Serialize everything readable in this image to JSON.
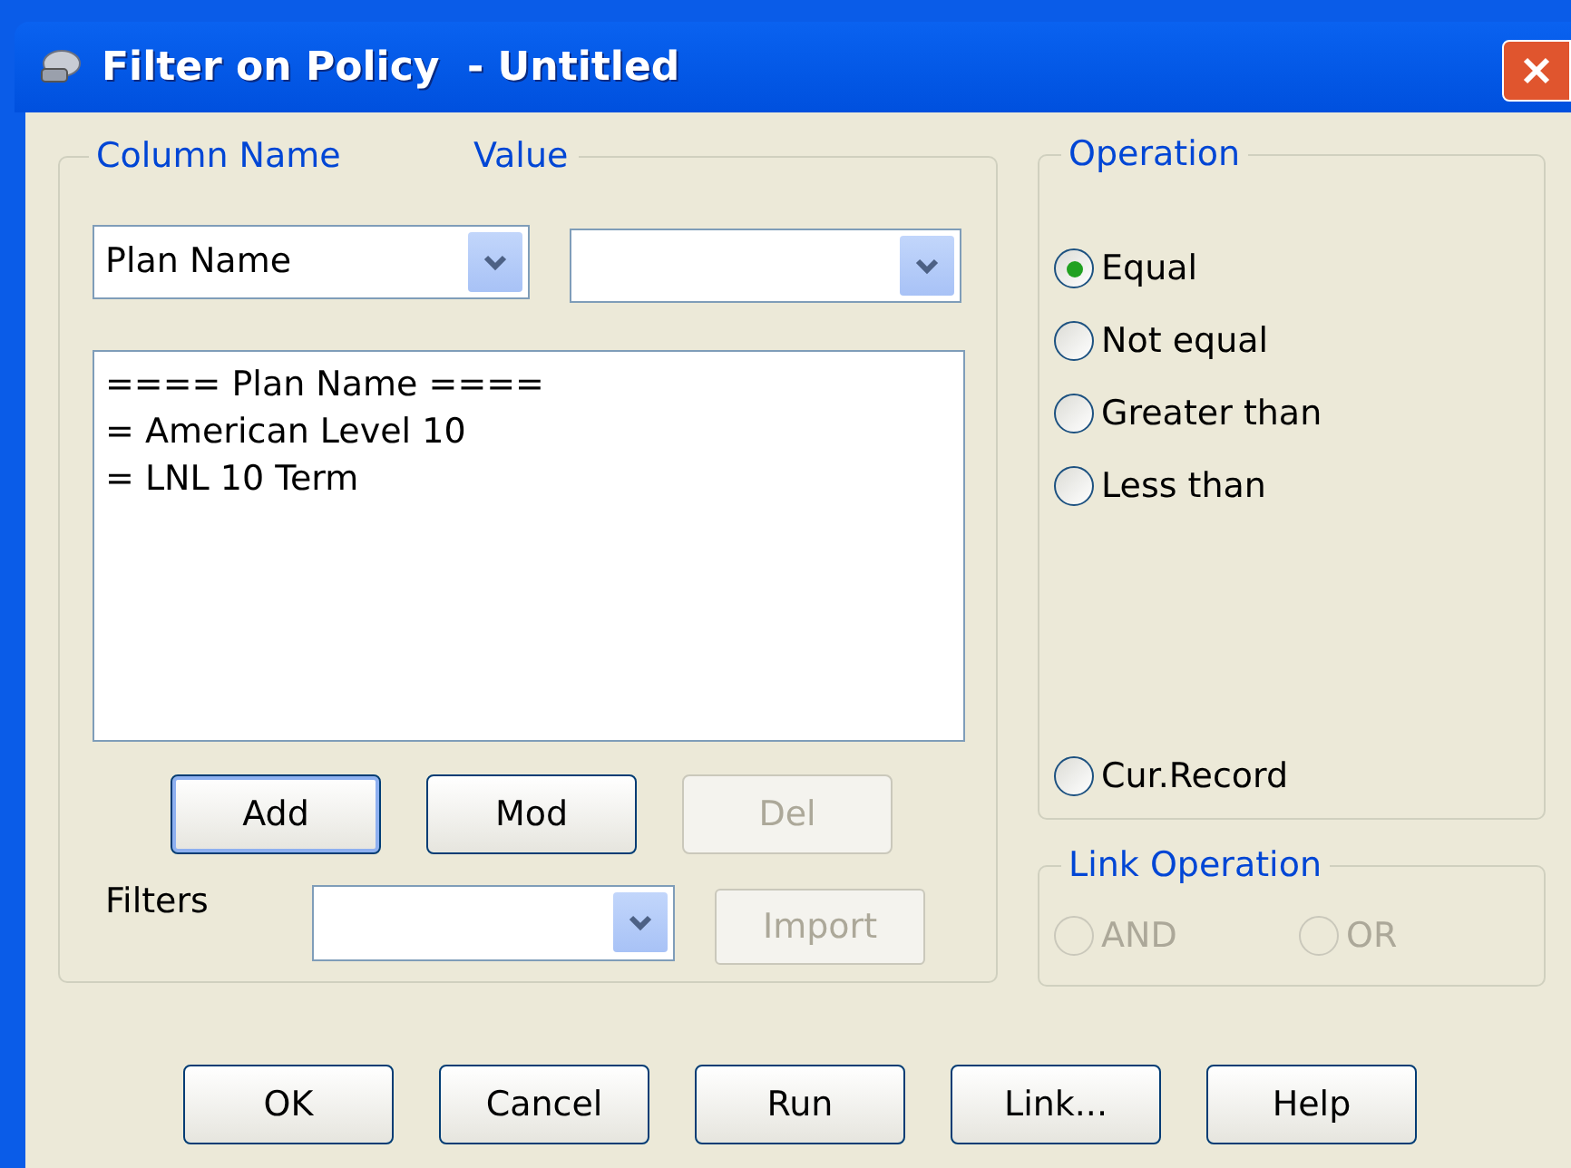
{
  "window": {
    "title": "Filter on Policy  - Untitled"
  },
  "criteria": {
    "labels": [
      "Column Name",
      "Value"
    ],
    "column_combo": {
      "value": "Plan Name"
    },
    "list_lines": [
      "==== Plan Name ====",
      "= American Level 10",
      "= LNL 10 Term"
    ],
    "actions": [
      {
        "label": "Add",
        "disabled": false,
        "focused": true
      },
      {
        "label": "Mod",
        "disabled": false,
        "focused": false
      },
      {
        "label": "Del",
        "disabled": true,
        "focused": false
      }
    ],
    "filters_label": "Filters",
    "import_button": {
      "label": "Import",
      "disabled": true
    }
  },
  "operation": {
    "label": "Operation",
    "options": [
      {
        "label": "Equal",
        "selected": true,
        "gap_before": false
      },
      {
        "label": "Not equal",
        "selected": false,
        "gap_before": false
      },
      {
        "label": "Greater than",
        "selected": false,
        "gap_before": false
      },
      {
        "label": "Less than",
        "selected": false,
        "gap_before": false
      },
      {
        "label": "Cur.Record",
        "selected": false,
        "gap_before": true
      }
    ]
  },
  "link_operation": {
    "label": "Link Operation",
    "options": [
      {
        "label": "AND",
        "selected": false,
        "disabled": true
      },
      {
        "label": "OR",
        "selected": false,
        "disabled": true
      }
    ]
  },
  "buttons": [
    "OK",
    "Cancel",
    "Run",
    "Link...",
    "Help"
  ]
}
